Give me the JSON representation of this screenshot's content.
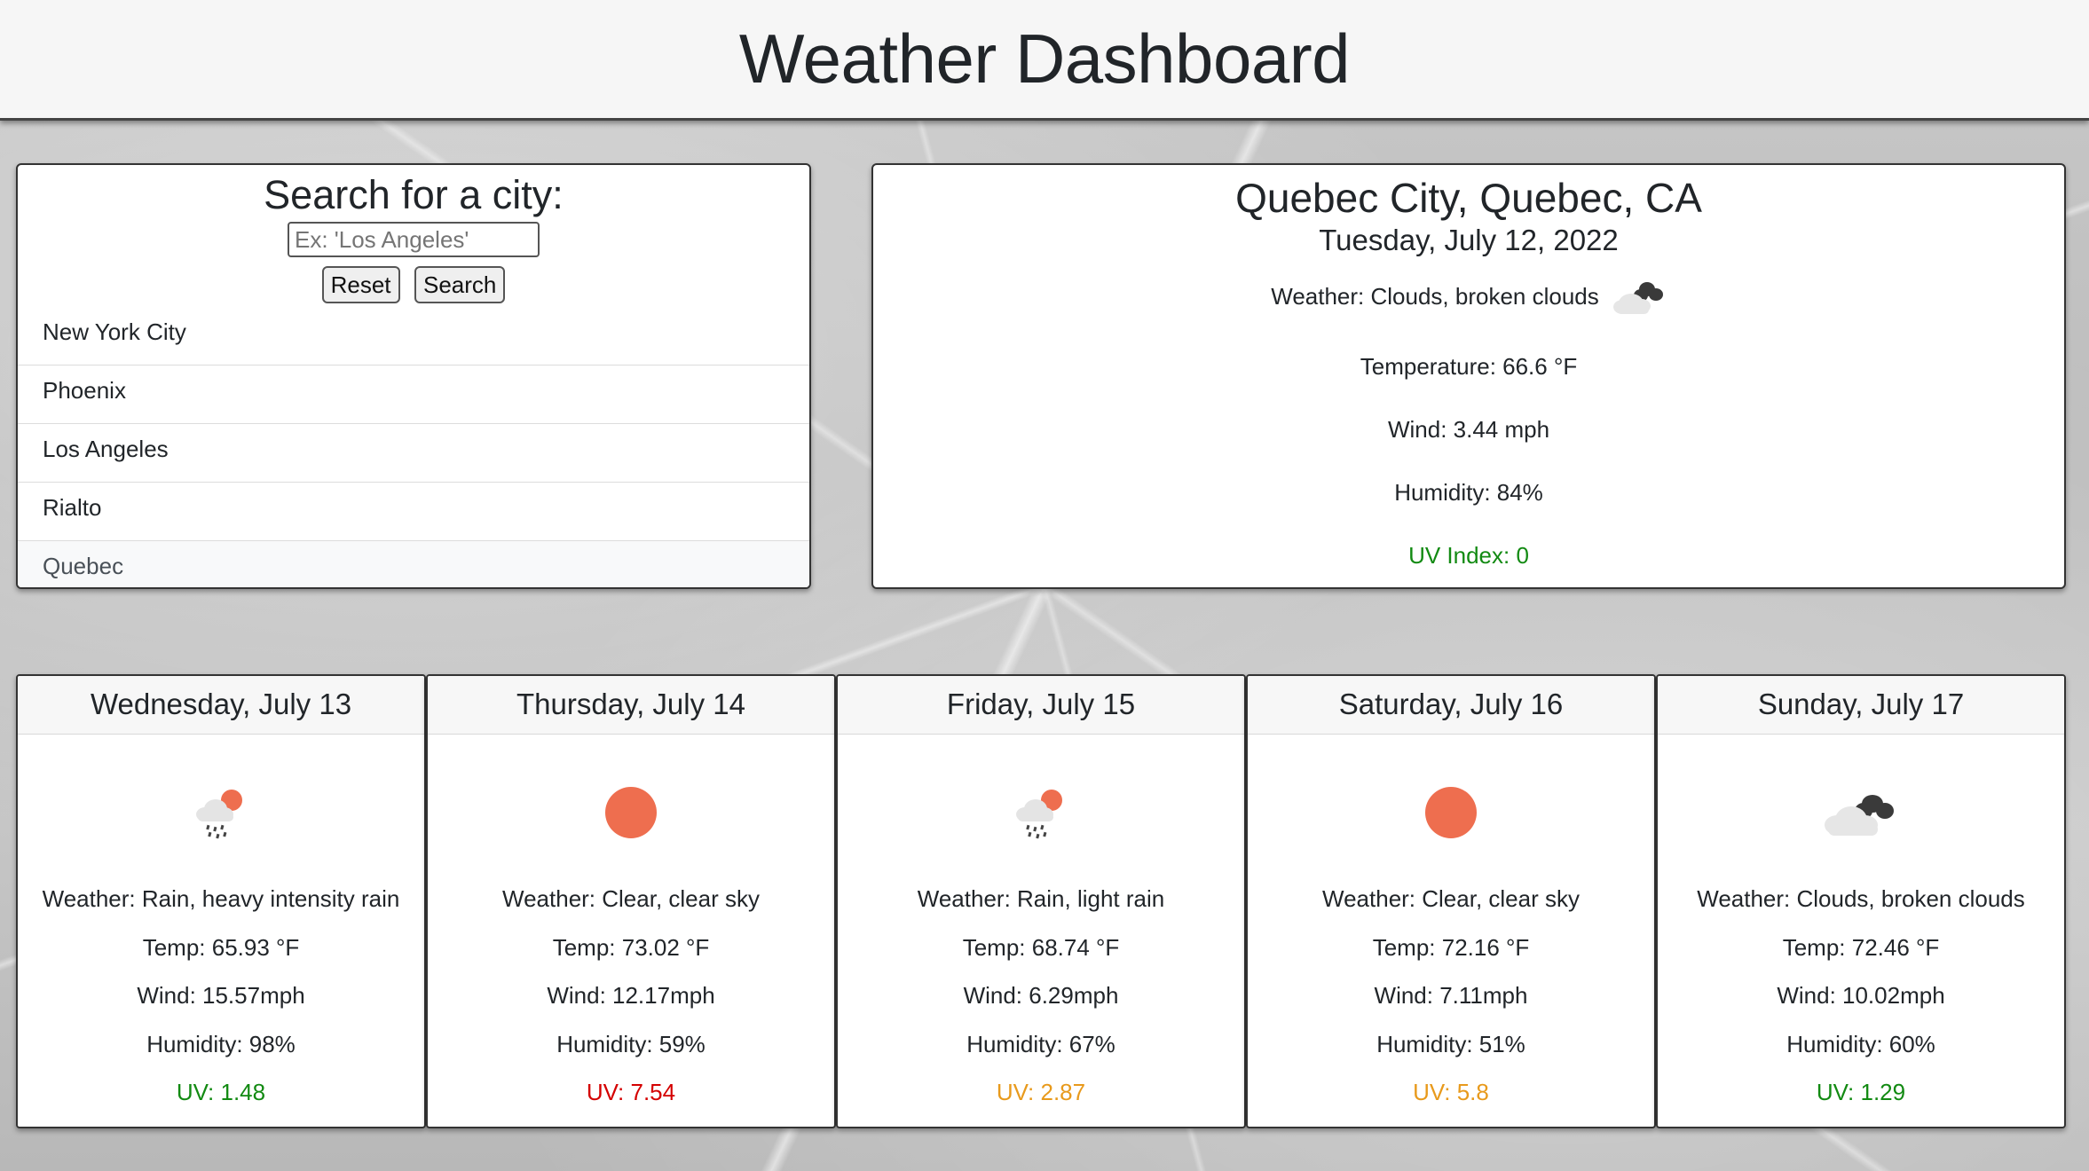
{
  "header": {
    "title": "Weather Dashboard"
  },
  "search": {
    "title": "Search for a city:",
    "placeholder": "Ex: 'Los Angeles'",
    "reset_label": "Reset",
    "search_label": "Search",
    "history": [
      "New York City",
      "Phoenix",
      "Los Angeles",
      "Rialto",
      "Quebec"
    ],
    "active_index": 4
  },
  "current": {
    "city": "Quebec City, Quebec, CA",
    "date": "Tuesday, July 12, 2022",
    "weather": "Weather: Clouds, broken clouds",
    "icon": "broken-clouds-icon",
    "temperature": "Temperature: 66.6 °F",
    "wind": "Wind: 3.44 mph",
    "humidity": "Humidity: 84%",
    "uv": "UV Index: 0",
    "uv_color": "#128a12"
  },
  "forecast": [
    {
      "day": "Wednesday, July 13",
      "icon": "rain-sun-icon",
      "weather": "Weather: Rain, heavy intensity rain",
      "temp": "Temp: 65.93 °F",
      "wind": "Wind: 15.57mph",
      "humidity": "Humidity: 98%",
      "uv": "UV: 1.48",
      "uv_color": "#128a12"
    },
    {
      "day": "Thursday, July 14",
      "icon": "sun-icon",
      "weather": "Weather: Clear, clear sky",
      "temp": "Temp: 73.02 °F",
      "wind": "Wind: 12.17mph",
      "humidity": "Humidity: 59%",
      "uv": "UV: 7.54",
      "uv_color": "#d40000"
    },
    {
      "day": "Friday, July 15",
      "icon": "rain-sun-icon",
      "weather": "Weather: Rain, light rain",
      "temp": "Temp: 68.74 °F",
      "wind": "Wind: 6.29mph",
      "humidity": "Humidity: 67%",
      "uv": "UV: 2.87",
      "uv_color": "#e89a1c"
    },
    {
      "day": "Saturday, July 16",
      "icon": "sun-icon",
      "weather": "Weather: Clear, clear sky",
      "temp": "Temp: 72.16 °F",
      "wind": "Wind: 7.11mph",
      "humidity": "Humidity: 51%",
      "uv": "UV: 5.8",
      "uv_color": "#e89a1c"
    },
    {
      "day": "Sunday, July 17",
      "icon": "broken-clouds-icon",
      "weather": "Weather: Clouds, broken clouds",
      "temp": "Temp: 72.46 °F",
      "wind": "Wind: 10.02mph",
      "humidity": "Humidity: 60%",
      "uv": "UV: 1.29",
      "uv_color": "#128a12"
    }
  ]
}
